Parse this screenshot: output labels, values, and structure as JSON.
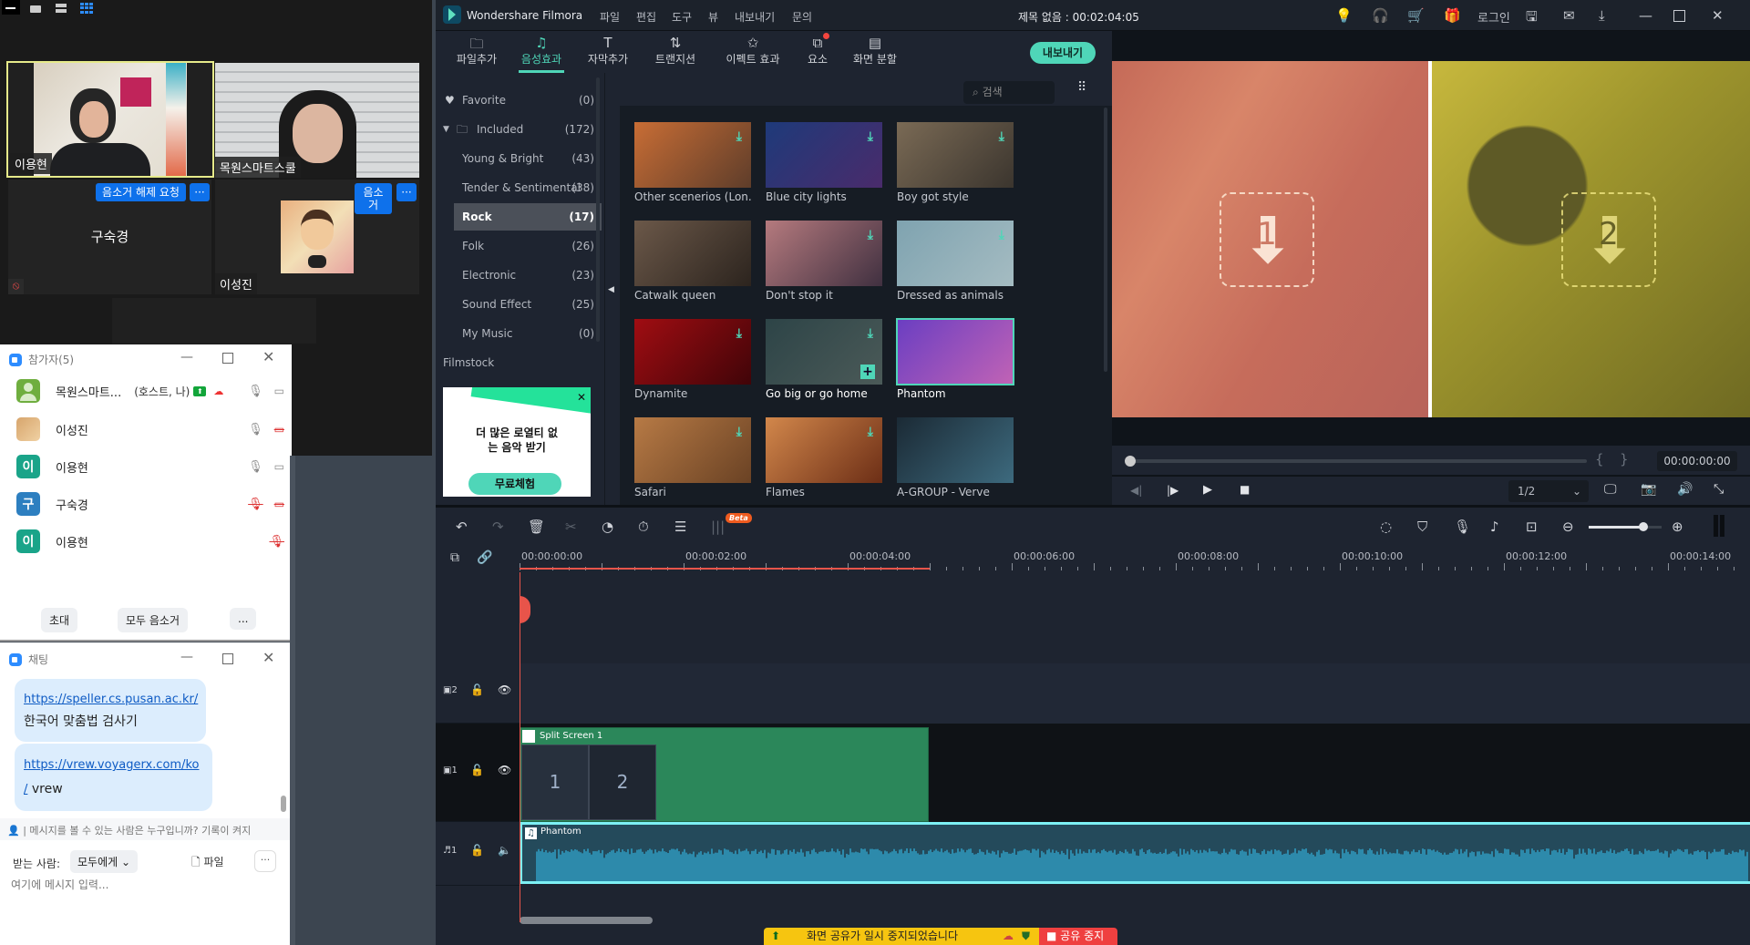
{
  "zoom_meeting": {
    "view_buttons": [
      "minimize-view",
      "speaker-view",
      "strip-view",
      "gallery-view"
    ],
    "tiles": [
      {
        "name": "이용현",
        "active_speaker": true
      },
      {
        "name": "목원스마트스쿨"
      },
      {
        "name": "구숙경",
        "muted": true
      },
      {
        "name": "이성진"
      }
    ],
    "unmute_request_label": "음소거 해제 요청",
    "mute_label": "음소거",
    "more_label": "···"
  },
  "participants": {
    "title": "참가자(5)",
    "list": [
      {
        "name": "목원스마트...",
        "tag": "(호스트, 나)",
        "avatar": "",
        "color": "#6fae3f",
        "mic": "on",
        "video": "on"
      },
      {
        "name": "이성진",
        "tag": "",
        "avatar": "",
        "color": "#c99a63",
        "mic": "on",
        "video": "off"
      },
      {
        "name": "이용현",
        "tag": "",
        "avatar": "이",
        "color": "#1aa489",
        "mic": "on",
        "video": "on"
      },
      {
        "name": "구숙경",
        "tag": "",
        "avatar": "구",
        "color": "#2d7fc0",
        "mic": "off",
        "video": "off"
      },
      {
        "name": "이용현",
        "tag": "",
        "avatar": "이",
        "color": "#1aa489",
        "mic": "off",
        "video": ""
      }
    ],
    "invite_label": "초대",
    "mute_all_label": "모두 음소거",
    "more_label": "..."
  },
  "chat": {
    "title": "채팅",
    "messages": [
      {
        "link": "https://speller.cs.pusan.ac.kr/",
        "text": "한국어 맞춤법 검사기"
      },
      {
        "link": "https://vrew.voyagerx.com/ko/",
        "link_part1": "https://vrew.voyagerx.com/ko",
        "link_part2": "/",
        "text": "vrew"
      }
    ],
    "privacy_notice": "| 메시지를 볼 수 있는 사람은 누구입니까? 기록이 켜지",
    "to_label": "받는 사람:",
    "to_value": "모두에게",
    "file_label": "파일",
    "more_label": "···",
    "input_placeholder": "여기에 메시지 입력..."
  },
  "filmora": {
    "app_name": "Wondershare Filmora",
    "menu": [
      "파일",
      "편집",
      "도구",
      "뷰",
      "내보내기",
      "문의"
    ],
    "project_title": "제목 없음 : 00:02:04:05",
    "login_label": "로그인",
    "tabs": [
      {
        "label": "파일추가",
        "icon": "folder"
      },
      {
        "label": "음성효과",
        "icon": "music",
        "active": true
      },
      {
        "label": "자막추가",
        "icon": "text"
      },
      {
        "label": "트랜지션",
        "icon": "transition"
      },
      {
        "label": "이펙트 효과",
        "icon": "effects"
      },
      {
        "label": "요소",
        "icon": "elements",
        "badge": true
      },
      {
        "label": "화면 분할",
        "icon": "split-screen"
      }
    ],
    "export_label": "내보내기",
    "sidebar": [
      {
        "label": "Favorite",
        "count": "(0)"
      },
      {
        "label": "Included",
        "count": "(172)"
      },
      {
        "label": "Young & Bright",
        "count": "(43)"
      },
      {
        "label": "Tender & Sentimental",
        "count": "(38)"
      },
      {
        "label": "Rock",
        "count": "(17)",
        "selected": true
      },
      {
        "label": "Folk",
        "count": "(26)"
      },
      {
        "label": "Electronic",
        "count": "(23)"
      },
      {
        "label": "Sound Effect",
        "count": "(25)"
      },
      {
        "label": "My Music",
        "count": "(0)"
      },
      {
        "label": "Filmstock",
        "count": ""
      }
    ],
    "promo": {
      "text1": "더 많은 로열티 없",
      "text2": "는 음악 받기",
      "button": "무료체험"
    },
    "search_placeholder": "검색",
    "media": [
      {
        "title": "Other scenerios  (Lon...",
        "colors": [
          "#c86d35",
          "#5e3d2a"
        ],
        "download": true
      },
      {
        "title": "Blue city lights",
        "colors": [
          "#1e3a7a",
          "#4a2b6b"
        ],
        "download": true
      },
      {
        "title": "Boy got style",
        "colors": [
          "#7a6a55",
          "#3b352e"
        ],
        "download": true
      },
      {
        "title": "Catwalk queen",
        "colors": [
          "#6b5849",
          "#2c241e"
        ],
        "download": false
      },
      {
        "title": "Don't stop it",
        "colors": [
          "#b57a7e",
          "#403040"
        ],
        "download": true
      },
      {
        "title": "Dressed as animals",
        "colors": [
          "#7fa3b0",
          "#a5bcc2"
        ],
        "download": true
      },
      {
        "title": "Dynamite",
        "colors": [
          "#a00d12",
          "#400408"
        ],
        "download": true
      },
      {
        "title": "Go big or go home",
        "colors": [
          "#2d4447",
          "#4b5a58"
        ],
        "download": true,
        "add": true
      },
      {
        "title": "Phantom",
        "colors": [
          "#6a3ec2",
          "#c163b5"
        ],
        "download": false,
        "selected": true
      },
      {
        "title": "Safari",
        "colors": [
          "#b77a45",
          "#6a4224"
        ],
        "download": true
      },
      {
        "title": "Flames",
        "colors": [
          "#d2874b",
          "#6c2e16"
        ],
        "download": true
      },
      {
        "title": "A-GROUP - Verve",
        "colors": [
          "#1b2a35",
          "#3d6a7e"
        ],
        "download": false
      }
    ],
    "preview": {
      "timecode": "00:00:00:00",
      "quality": "1/2",
      "placeholders": [
        "1",
        "2"
      ]
    },
    "timeline": {
      "ruler": [
        "00:00:00:00",
        "00:00:02:00",
        "00:00:04:00",
        "00:00:06:00",
        "00:00:08:00",
        "00:00:10:00",
        "00:00:12:00",
        "00:00:14:00"
      ],
      "beta_label": "Beta",
      "tracks": [
        {
          "id": "video2",
          "label": "2"
        },
        {
          "id": "video1",
          "label": "1"
        },
        {
          "id": "audio1",
          "label": "1"
        }
      ],
      "split_clip": {
        "title": "Split Screen 1",
        "cells": [
          "1",
          "2"
        ]
      },
      "audio_clip": {
        "title": "Phantom"
      },
      "zoom_level": 0.75
    }
  },
  "share_banner": {
    "text": "화면 공유가 일시 중지되었습니다",
    "stop_label": "공유 중지"
  }
}
